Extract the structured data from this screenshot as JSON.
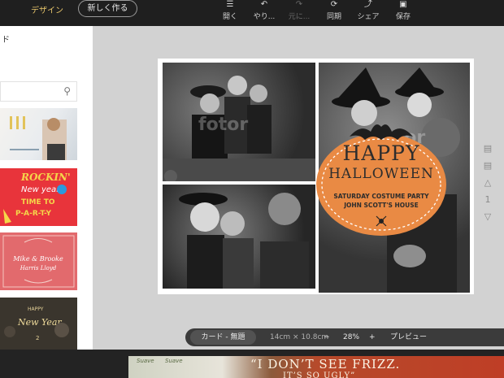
{
  "topbar": {
    "nav_design": "デザイン",
    "new_button": "新しく作る",
    "tools": [
      {
        "label": "開く",
        "icon": "menu-icon"
      },
      {
        "label": "やり...",
        "icon": "undo-icon"
      },
      {
        "label": "元に...",
        "icon": "redo-icon"
      },
      {
        "label": "同期",
        "icon": "sync-icon"
      },
      {
        "label": "シェア",
        "icon": "share-icon"
      },
      {
        "label": "保存",
        "icon": "save-icon"
      }
    ]
  },
  "sidebar": {
    "title_fragment": "ド",
    "templates": [
      {
        "name": "white-photo-template"
      },
      {
        "name": "rockin-new-year",
        "lines": [
          "ROCKIN'",
          "New year",
          "TIME TO",
          "P-A-R-T-Y"
        ]
      },
      {
        "name": "mike-brooke-wedding",
        "lines": [
          "Mike & Brooke",
          "Harris   Lloyd"
        ]
      },
      {
        "name": "happy-new-year",
        "lines": [
          "HAPPY",
          "New Year",
          "2"
        ]
      },
      {
        "name": "purple-template"
      }
    ]
  },
  "canvas": {
    "happy": "HAPPY",
    "halloween": "HALLOWEEN",
    "subtitle1": "SATURDAY COSTUME PARTY",
    "subtitle2": "JOHN SCOTT'S HOUSE",
    "watermark": "fotor",
    "pumpkin_color": "#e98a44",
    "bat_color": "#1e1e1e"
  },
  "pagetools": {
    "page_number": "1"
  },
  "statusbar": {
    "doc_name": "カード - 無題",
    "size": "14cm × 10.8cm",
    "zoom_minus": "−",
    "zoom": "28%",
    "zoom_plus": "+",
    "preview": "プレビュー"
  },
  "ad": {
    "text_line1": "“I DON’T SEE FRIZZ.",
    "text_line2": "IT’S SO UGLY”",
    "brand1": "Suave",
    "brand2": "Suave"
  }
}
